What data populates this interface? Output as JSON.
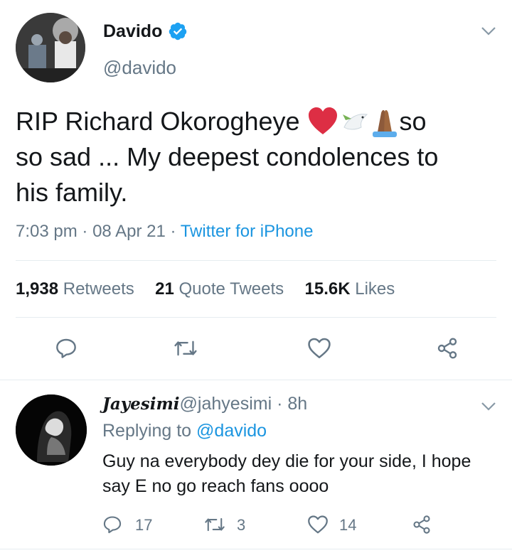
{
  "tweet": {
    "author_name": "Davido",
    "author_handle": "@davido",
    "verified": true,
    "text_line1": "RIP Richard Okorogheye ",
    "emojis": "❤️🕊🙏🏾",
    "text_line1_end": "so",
    "text_line2": "so sad ... My deepest condolences to",
    "text_line3": "his family.",
    "time": "7:03 pm",
    "date": "08 Apr 21",
    "source": "Twitter for iPhone",
    "retweets_count": "1,938",
    "retweets_label": "Retweets",
    "quote_count": "21",
    "quote_label": "Quote Tweets",
    "likes_count": "15.6K",
    "likes_label": "Likes"
  },
  "reply": {
    "author_name": "Jayesimi",
    "author_handle": "@jahyesimi",
    "time_ago": "8h",
    "replying_label": "Replying to",
    "replying_handle": "@davido",
    "text_line1": "Guy na everybody dey die for your side, I hope",
    "text_line2": "say E no go reach fans oooo",
    "reply_count": "17",
    "retweet_count": "3",
    "like_count": "14"
  },
  "colors": {
    "accent": "#1b95e0",
    "muted": "#657786",
    "divider": "#e6ecf0"
  }
}
